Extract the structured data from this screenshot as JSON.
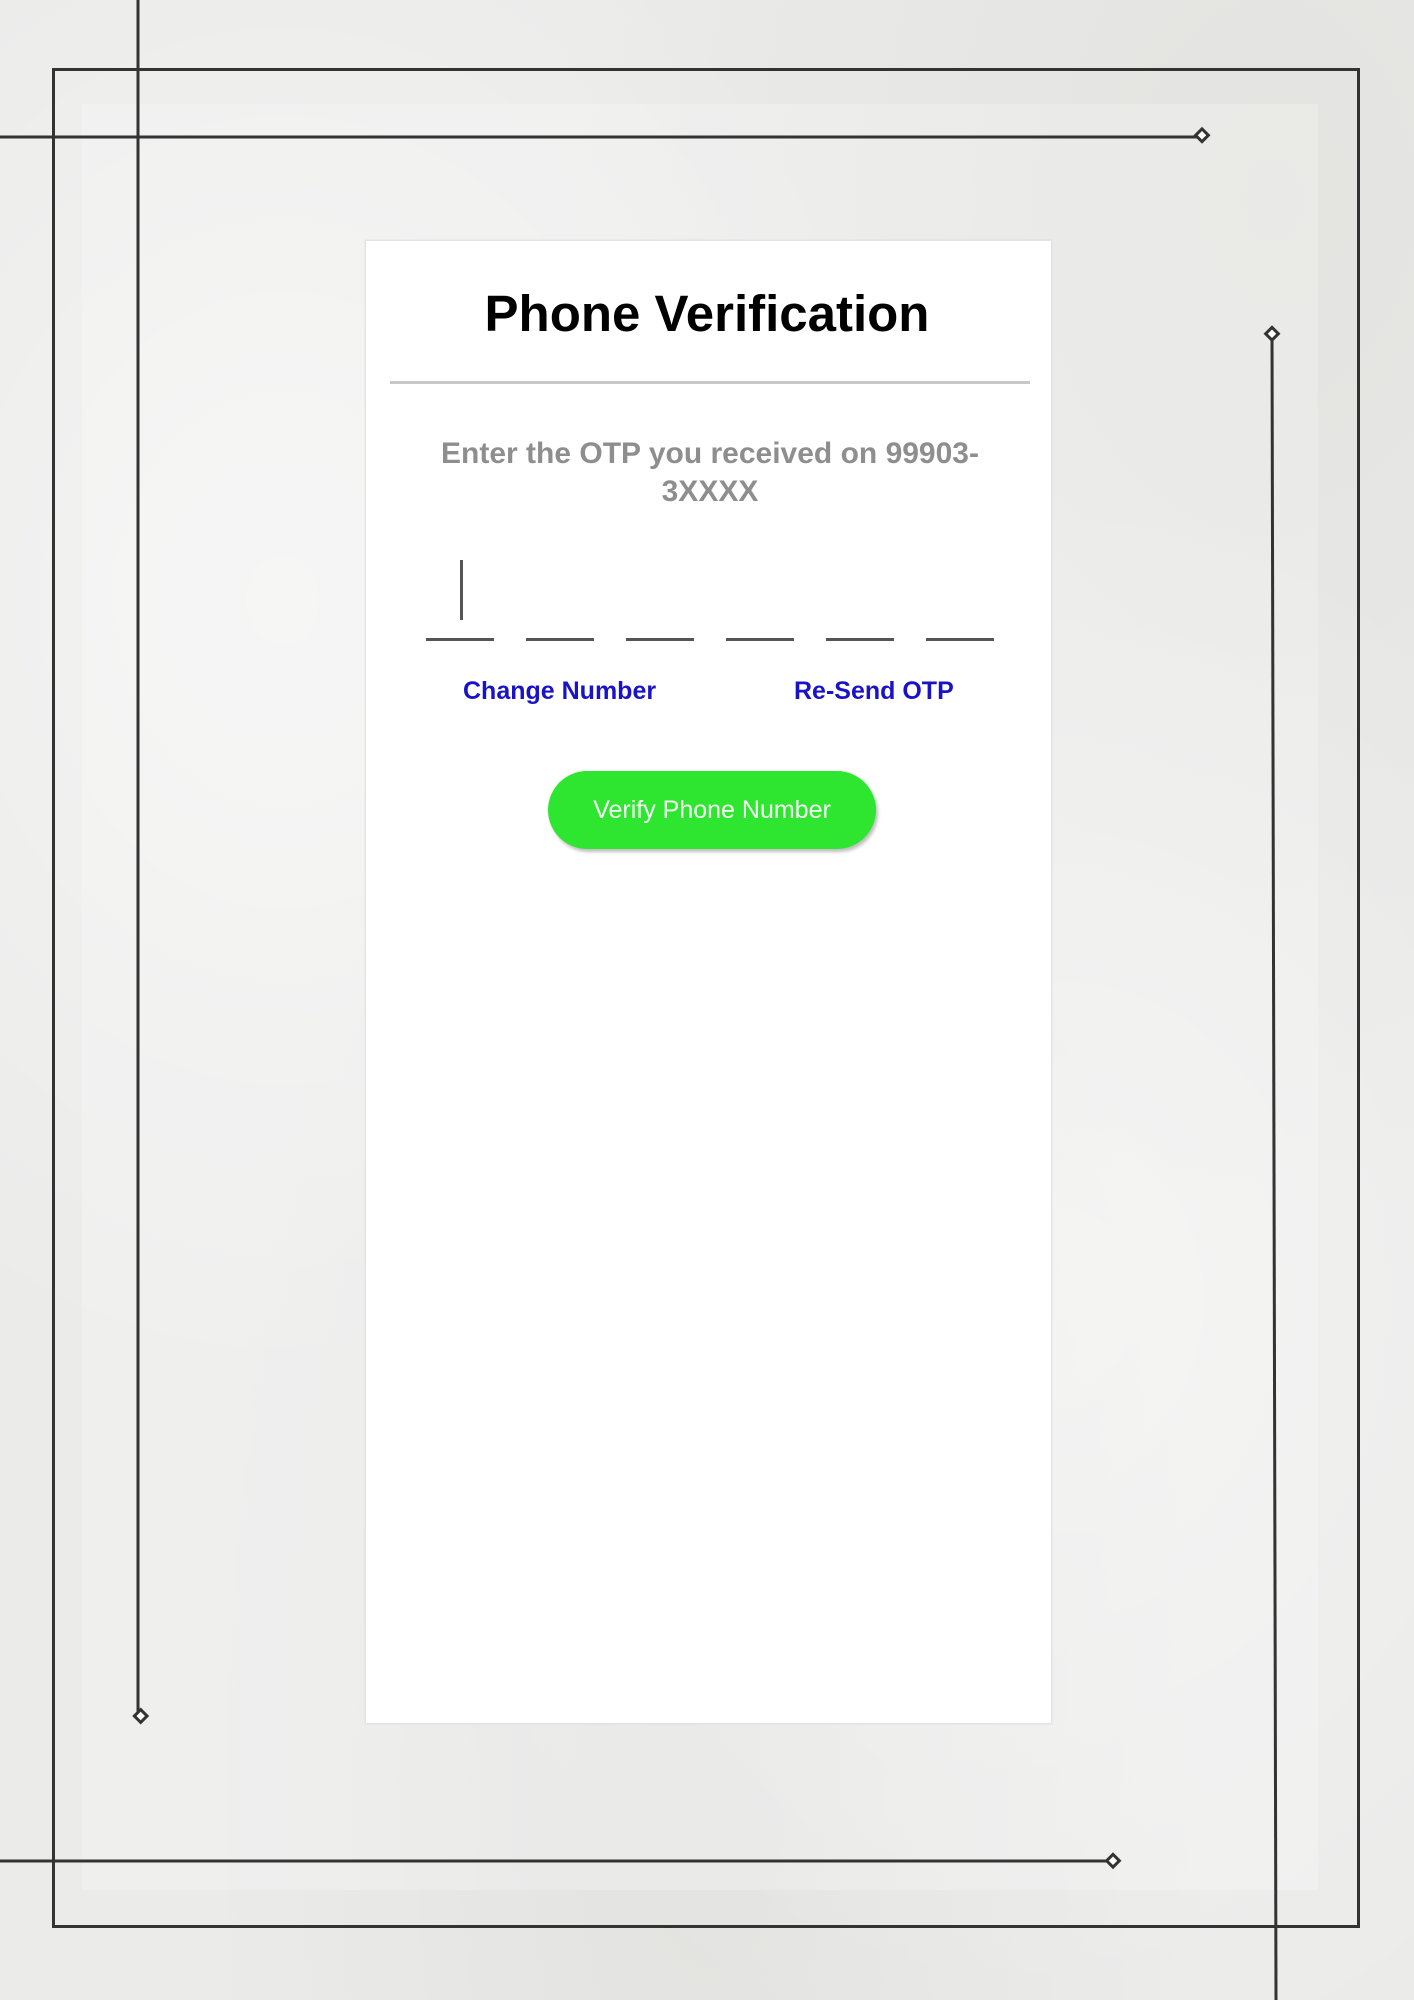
{
  "card": {
    "title": "Phone Verification",
    "prompt": "Enter the OTP you received on 99903-3XXXX",
    "otp_digits": [
      "",
      "",
      "",
      "",
      "",
      ""
    ],
    "change_number_label": "Change Number",
    "resend_otp_label": "Re-Send OTP",
    "verify_button_label": "Verify Phone Number"
  },
  "colors": {
    "link": "#1a12c9",
    "verify_button": "#2ee630",
    "prompt_text": "#8e8e8e",
    "frame_lines": "#333333"
  }
}
